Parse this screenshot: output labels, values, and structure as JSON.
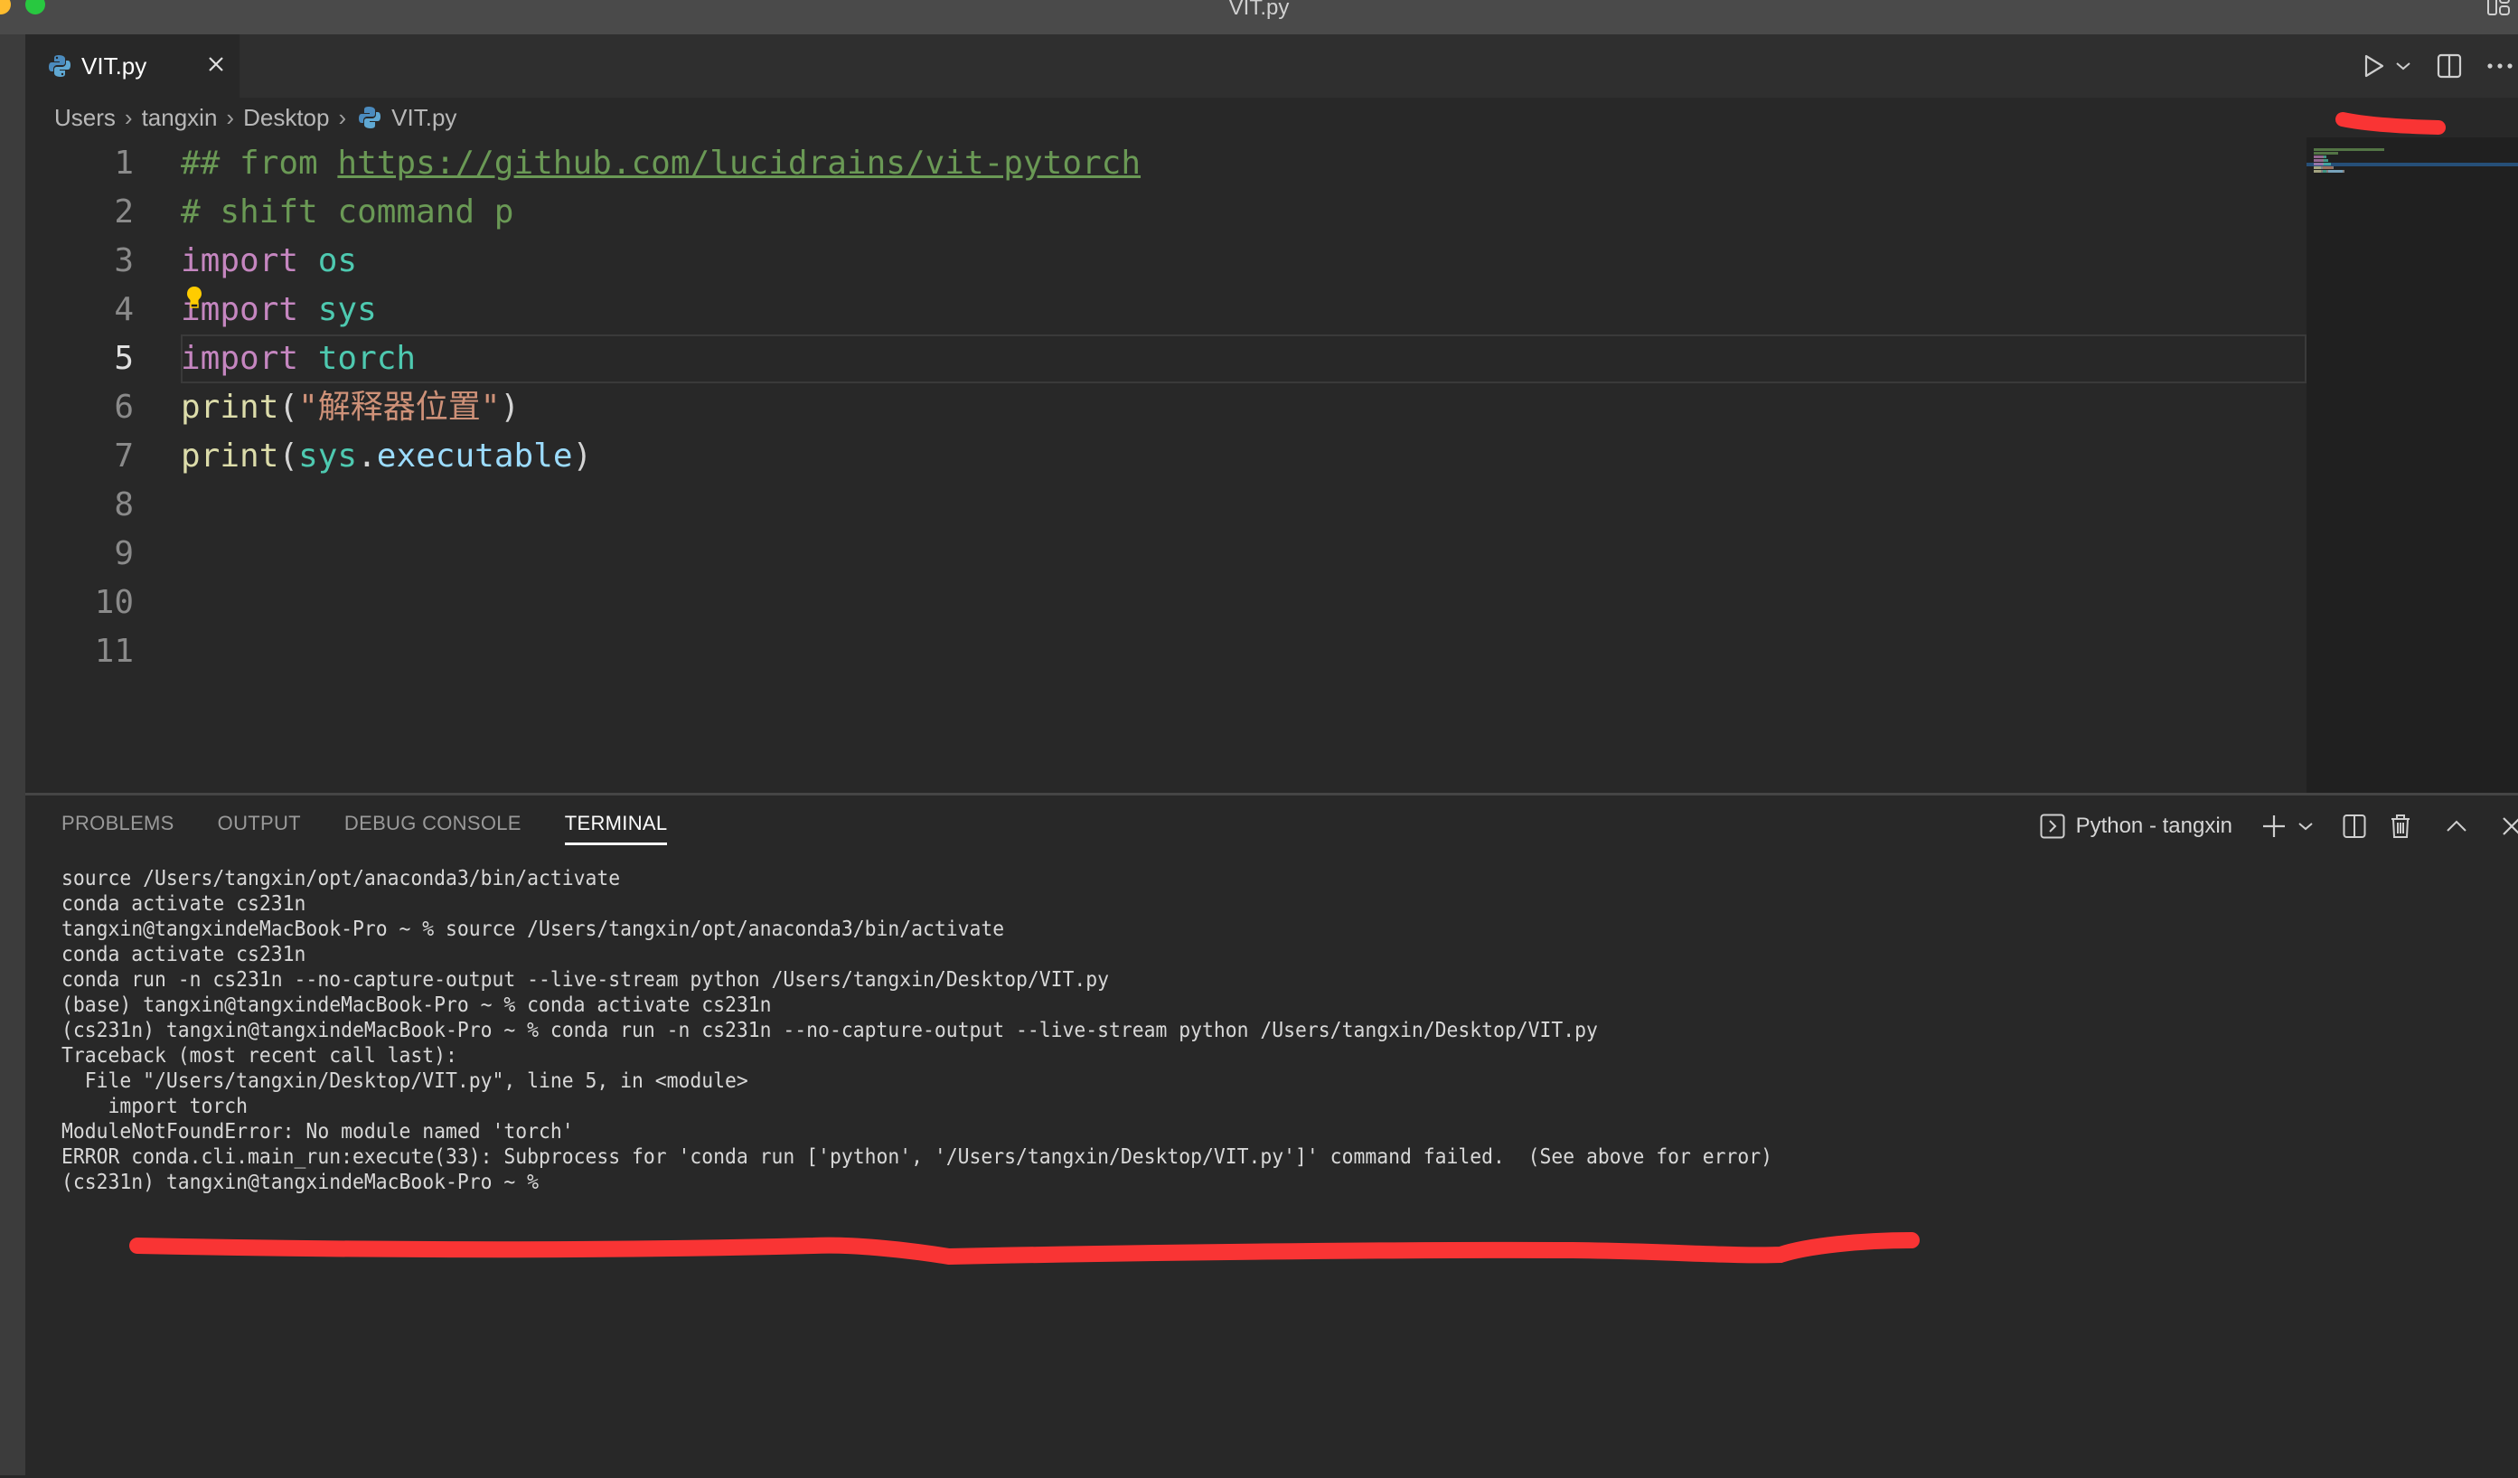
{
  "window": {
    "title": "VIT.py",
    "traffic_lights": [
      {
        "name": "minimize",
        "color": "#febc2e"
      },
      {
        "name": "maximize",
        "color": "#28c840"
      }
    ]
  },
  "tabs": [
    {
      "label": "VIT.py",
      "icon": "python-icon",
      "active": true,
      "close_icon": "close-icon"
    }
  ],
  "tab_actions": [
    {
      "name": "run-python-file",
      "icon": "play-icon"
    },
    {
      "name": "run-options",
      "icon": "chevron-down-icon"
    },
    {
      "name": "split-editor",
      "icon": "split-editor-icon"
    },
    {
      "name": "more-actions",
      "icon": "ellipsis-icon"
    }
  ],
  "breadcrumb": [
    "Users",
    "tangxin",
    "Desktop",
    "VIT.py"
  ],
  "editor": {
    "active_line": 5,
    "lines": [
      {
        "n": "1",
        "tokens": [
          {
            "t": "## from ",
            "c": "comment"
          },
          {
            "t": "https://github.com/lucidrains/vit-pytorch",
            "c": "link"
          }
        ]
      },
      {
        "n": "2",
        "tokens": [
          {
            "t": "# shift command p",
            "c": "comment"
          }
        ]
      },
      {
        "n": "3",
        "tokens": [
          {
            "t": "import",
            "c": "kw"
          },
          {
            "t": " ",
            "c": "punc"
          },
          {
            "t": "os",
            "c": "mod"
          }
        ]
      },
      {
        "n": "4",
        "tokens": [
          {
            "t": "import",
            "c": "kw"
          },
          {
            "t": " ",
            "c": "punc"
          },
          {
            "t": "sys",
            "c": "mod"
          }
        ]
      },
      {
        "n": "5",
        "tokens": [
          {
            "t": "import",
            "c": "kw"
          },
          {
            "t": " ",
            "c": "punc"
          },
          {
            "t": "torch",
            "c": "mod"
          }
        ]
      },
      {
        "n": "6",
        "tokens": [
          {
            "t": "print",
            "c": "fn"
          },
          {
            "t": "(",
            "c": "punc"
          },
          {
            "t": "\"解释器位置\"",
            "c": "str"
          },
          {
            "t": ")",
            "c": "punc"
          }
        ]
      },
      {
        "n": "7",
        "tokens": [
          {
            "t": "print",
            "c": "fn"
          },
          {
            "t": "(",
            "c": "punc"
          },
          {
            "t": "sys",
            "c": "mod"
          },
          {
            "t": ".",
            "c": "punc"
          },
          {
            "t": "executable",
            "c": "var"
          },
          {
            "t": ")",
            "c": "punc"
          }
        ]
      },
      {
        "n": "8",
        "tokens": []
      },
      {
        "n": "9",
        "tokens": []
      },
      {
        "n": "10",
        "tokens": []
      },
      {
        "n": "11",
        "tokens": []
      }
    ]
  },
  "panel": {
    "tabs": [
      "PROBLEMS",
      "OUTPUT",
      "DEBUG CONSOLE",
      "TERMINAL"
    ],
    "active_tab": "TERMINAL",
    "terminal_name": "Python - tangxin",
    "actions": [
      {
        "name": "new-terminal",
        "icon": "plus-icon"
      },
      {
        "name": "terminal-profiles",
        "icon": "chevron-down-icon"
      },
      {
        "name": "split-terminal",
        "icon": "split-icon"
      },
      {
        "name": "kill-terminal",
        "icon": "trash-icon"
      },
      {
        "name": "maximize-panel",
        "icon": "chevron-up-icon"
      },
      {
        "name": "close-panel",
        "icon": "close-icon"
      }
    ]
  },
  "terminal": {
    "lines": [
      "source /Users/tangxin/opt/anaconda3/bin/activate",
      "conda activate cs231n",
      "tangxin@tangxindeMacBook-Pro ~ % source /Users/tangxin/opt/anaconda3/bin/activate",
      "conda activate cs231n",
      "conda run -n cs231n --no-capture-output --live-stream python /Users/tangxin/Desktop/VIT.py",
      "(base) tangxin@tangxindeMacBook-Pro ~ % conda activate cs231n",
      "(cs231n) tangxin@tangxindeMacBook-Pro ~ % conda run -n cs231n --no-capture-output --live-stream python /Users/tangxin/Desktop/VIT.py",
      "Traceback (most recent call last):",
      "  File \"/Users/tangxin/Desktop/VIT.py\", line 5, in <module>",
      "    import torch",
      "ModuleNotFoundError: No module named 'torch'",
      "ERROR conda.cli.main_run:execute(33): Subprocess for 'conda run ['python', '/Users/tangxin/Desktop/VIT.py']' command failed.  (See above for error)",
      "(cs231n) tangxin@tangxindeMacBook-Pro ~ % "
    ]
  },
  "colors": {
    "annotation": "#f93434",
    "comment": "#6a9955",
    "keyword": "#c586c0",
    "module": "#4ec9b0",
    "function": "#dcdcaa",
    "string": "#ce9178",
    "variable": "#9cdcfe"
  }
}
